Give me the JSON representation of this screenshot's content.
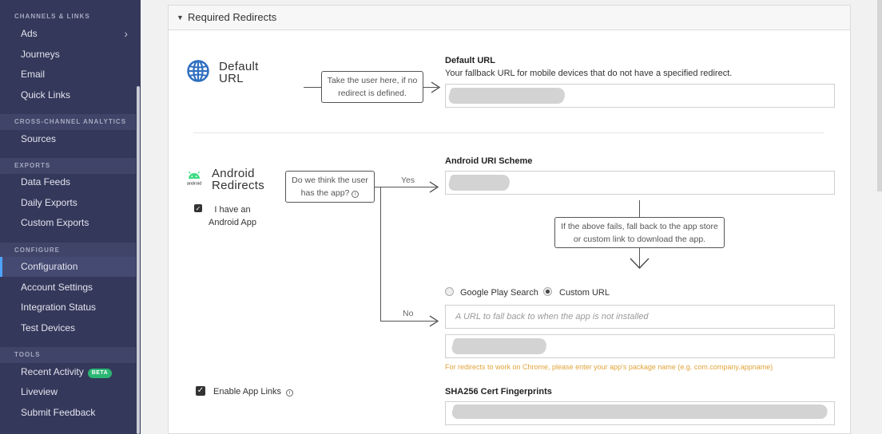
{
  "sidebar": {
    "sections": [
      {
        "label": "CHANNELS & LINKS"
      },
      {
        "label": "CROSS-CHANNEL ANALYTICS"
      },
      {
        "label": "EXPORTS"
      },
      {
        "label": "CONFIGURE"
      },
      {
        "label": "TOOLS"
      }
    ],
    "items": [
      {
        "label": "Ads"
      },
      {
        "label": "Journeys"
      },
      {
        "label": "Email"
      },
      {
        "label": "Quick Links"
      },
      {
        "label": "Sources"
      },
      {
        "label": "Data Feeds"
      },
      {
        "label": "Daily Exports"
      },
      {
        "label": "Custom Exports"
      },
      {
        "label": "Configuration"
      },
      {
        "label": "Account Settings"
      },
      {
        "label": "Integration Status"
      },
      {
        "label": "Test Devices"
      },
      {
        "label": "Recent Activity"
      },
      {
        "label": "Liveview"
      },
      {
        "label": "Submit Feedback"
      }
    ],
    "beta_badge": "BETA",
    "active_item": "Configuration"
  },
  "main": {
    "panel_title": "Required Redirects",
    "default_url": {
      "title_line1": "Default",
      "title_line2": "URL",
      "callout": [
        "Take the user here, if no",
        "redirect is defined."
      ],
      "label": "Default URL",
      "description": "Your fallback URL for mobile devices that do not have a specified redirect."
    },
    "android": {
      "logo_text": "android",
      "title_line1": "Android",
      "title_line2": "Redirects",
      "has_app_label_line1": "I have an",
      "has_app_label_line2": "Android App",
      "has_app_checked": true,
      "question_callout": [
        "Do we think the user",
        "has the app?"
      ],
      "yes_label": "Yes",
      "no_label": "No",
      "uri_scheme_label": "Android URI Scheme",
      "fallback_callout": [
        "If the above fails, fall back to the app store",
        "or custom link to download the app."
      ],
      "radio_google_play": "Google Play Search",
      "radio_custom_url": "Custom URL",
      "selected_radio": "Custom URL",
      "custom_url_placeholder": "A URL to fall back to when the app is not installed",
      "package_hint": "For redirects to work on Chrome, please enter your app's package name (e.g. com.company.appname)",
      "enable_app_links_label": "Enable App Links",
      "enable_app_links_checked": true,
      "sha256_label": "SHA256 Cert Fingerprints"
    }
  },
  "colors": {
    "sidebar_bg": "#34385a",
    "active_accent": "#4ea3ff",
    "beta_badge": "#2bb673",
    "globe_icon": "#2f6fc0",
    "android_green": "#3ddc84",
    "hint_text": "#e0a43a"
  },
  "icons": [
    "globe-icon",
    "android-logo-icon",
    "info-icon",
    "chevron-right-icon",
    "caret-down-icon",
    "arrow-right-icon",
    "arrow-down-icon"
  ]
}
